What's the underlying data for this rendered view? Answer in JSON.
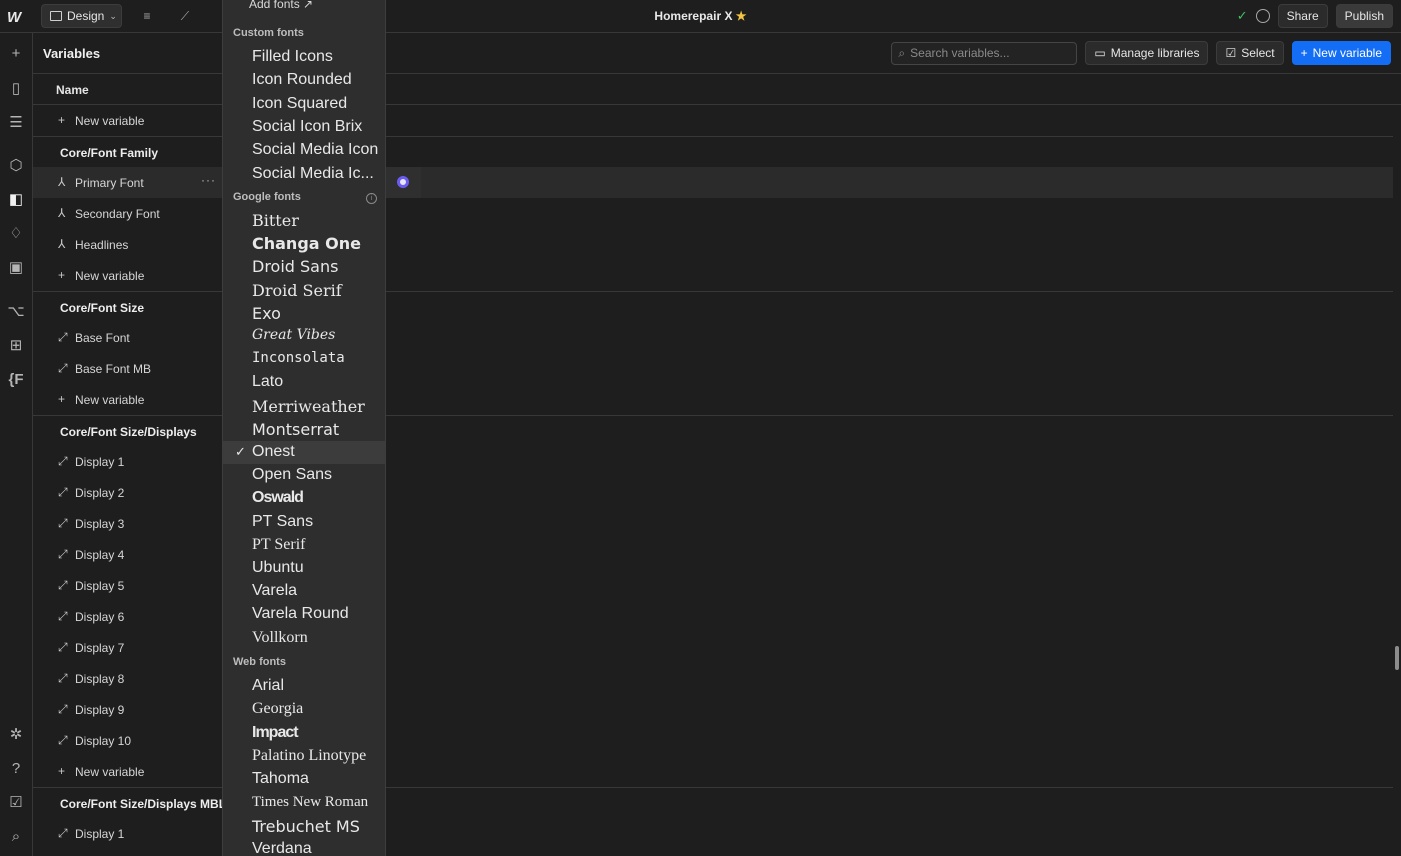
{
  "topbar": {
    "mode": "Design",
    "title": "Homerepair X",
    "title_star": "★",
    "share": "Share",
    "publish": "Publish"
  },
  "panel": {
    "title": "Variables",
    "search_placeholder": "Search variables...",
    "manage": "Manage libraries",
    "select": "Select",
    "new_variable": "New variable",
    "col_name": "Name"
  },
  "rows": [
    {
      "type": "new",
      "label": "New variable"
    },
    {
      "type": "group",
      "label": "Core/Font Family"
    },
    {
      "type": "font",
      "label": "Primary Font",
      "more": "···"
    },
    {
      "type": "font",
      "label": "Secondary Font"
    },
    {
      "type": "font",
      "label": "Headlines"
    },
    {
      "type": "new",
      "label": "New variable"
    },
    {
      "type": "group",
      "label": "Core/Font Size"
    },
    {
      "type": "size",
      "label": "Base Font"
    },
    {
      "type": "size",
      "label": "Base Font MB"
    },
    {
      "type": "new",
      "label": "New variable"
    },
    {
      "type": "group",
      "label": "Core/Font Size/Displays"
    },
    {
      "type": "size",
      "label": "Display 1"
    },
    {
      "type": "size",
      "label": "Display 2"
    },
    {
      "type": "size",
      "label": "Display 3"
    },
    {
      "type": "size",
      "label": "Display 4"
    },
    {
      "type": "size",
      "label": "Display 5"
    },
    {
      "type": "size",
      "label": "Display 6"
    },
    {
      "type": "size",
      "label": "Display 7"
    },
    {
      "type": "size",
      "label": "Display 8"
    },
    {
      "type": "size",
      "label": "Display 9"
    },
    {
      "type": "size",
      "label": "Display 10"
    },
    {
      "type": "new",
      "label": "New variable"
    },
    {
      "type": "group",
      "label": "Core/Font Size/Displays MBL"
    },
    {
      "type": "size",
      "label": "Display 1"
    }
  ],
  "dropdown": {
    "add_fonts": "Add fonts",
    "custom_label": "Custom fonts",
    "custom": [
      "Filled Icons",
      "Icon Rounded",
      "Icon Squared",
      "Social Icon Brix",
      "Social Media Icon",
      "Social Media Ic..."
    ],
    "google_label": "Google fonts",
    "google": [
      "Bitter",
      "Changa One",
      "Droid Sans",
      "Droid Serif",
      "Exo",
      "Great Vibes",
      "Inconsolata",
      "Lato",
      "Merriweather",
      "Montserrat",
      "Onest",
      "Open Sans",
      "Oswald",
      "PT Sans",
      "PT Serif",
      "Ubuntu",
      "Varela",
      "Varela Round",
      "Vollkorn"
    ],
    "selected": "Onest",
    "web_label": "Web fonts",
    "web": [
      "Arial",
      "Georgia",
      "Impact",
      "Palatino Linotype",
      "Tahoma",
      "Times New Roman",
      "Trebuchet MS",
      "Verdana"
    ]
  },
  "colors": {
    "accent": "#146ef5",
    "selected_dot": "#6b5cf0",
    "success": "#3fbf66",
    "star": "#f4c542"
  }
}
